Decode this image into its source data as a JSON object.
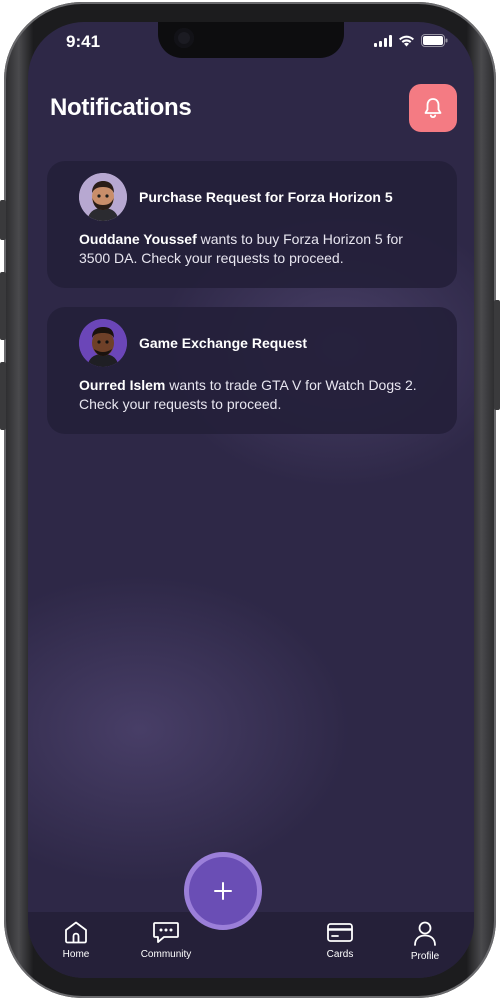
{
  "status_bar": {
    "time": "9:41"
  },
  "header": {
    "title": "Notifications"
  },
  "notifications": [
    {
      "title": "Purchase Request for Forza Horizon 5",
      "sender": "Ouddane Youssef",
      "message": " wants to buy Forza Horizon 5 for 3500 DA. Check your requests to proceed."
    },
    {
      "title": "Game Exchange Request",
      "sender": "Ourred Islem",
      "message": " wants to trade GTA V for Watch Dogs 2. Check your requests to proceed."
    }
  ],
  "tab_bar": {
    "home": "Home",
    "community": "Community",
    "cards": "Cards",
    "profile": "Profile"
  },
  "colors": {
    "background": "#2e2847",
    "card": "#241f3a",
    "accent_bell": "#f47b83",
    "fab": "#6a4eb5",
    "fab_ring": "#9b7fd9"
  },
  "icons": {
    "bell": "bell-icon",
    "plus": "plus-icon",
    "home": "home-icon",
    "community": "chat-bubble-icon",
    "cards": "card-icon",
    "profile": "person-icon"
  }
}
